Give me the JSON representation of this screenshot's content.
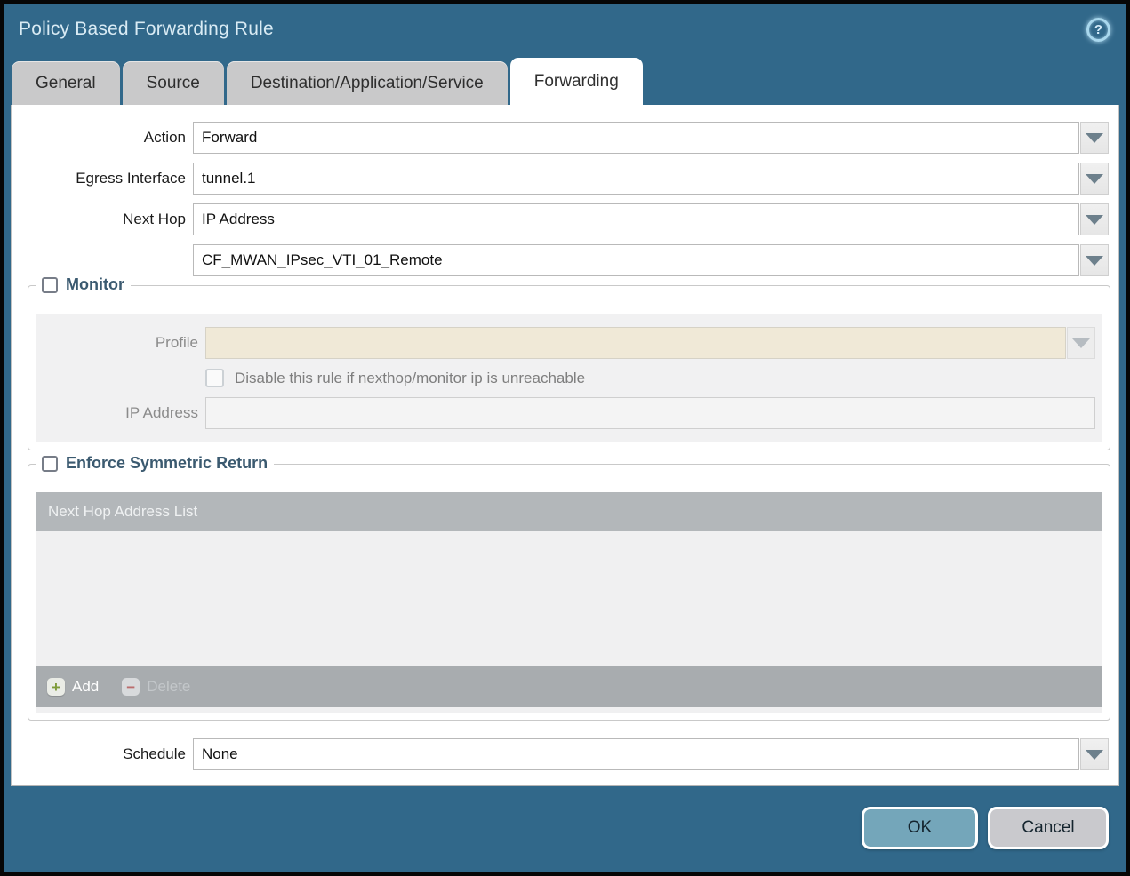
{
  "dialog": {
    "title": "Policy Based Forwarding Rule"
  },
  "icons": {
    "help": "?",
    "add": "+",
    "delete": "−",
    "dropdown": "triangle-down"
  },
  "tabs": [
    {
      "label": "General",
      "active": false
    },
    {
      "label": "Source",
      "active": false
    },
    {
      "label": "Destination/Application/Service",
      "active": false
    },
    {
      "label": "Forwarding",
      "active": true
    }
  ],
  "form": {
    "action": {
      "label": "Action",
      "value": "Forward"
    },
    "egress_interface": {
      "label": "Egress Interface",
      "value": "tunnel.1"
    },
    "next_hop": {
      "label": "Next Hop",
      "value": "IP Address"
    },
    "next_hop_address": {
      "value": "CF_MWAN_IPsec_VTI_01_Remote"
    },
    "monitor": {
      "legend": "Monitor",
      "checked": false,
      "profile": {
        "label": "Profile",
        "value": ""
      },
      "disable_rule": {
        "label": "Disable this rule if nexthop/monitor ip is unreachable",
        "checked": false
      },
      "ip_address": {
        "label": "IP Address",
        "value": ""
      }
    },
    "enforce_symmetric_return": {
      "legend": "Enforce Symmetric Return",
      "checked": false,
      "table_header": "Next Hop Address List",
      "rows": [],
      "add_label": "Add",
      "delete_label": "Delete"
    },
    "schedule": {
      "label": "Schedule",
      "value": "None"
    }
  },
  "footer": {
    "ok_label": "OK",
    "cancel_label": "Cancel"
  },
  "colors": {
    "chrome_teal": "#31688a",
    "active_tab": "#ffffff",
    "inactive_tab": "#c9c9ca",
    "disabled_beige": "#f0e9d7",
    "table_header_gray": "#b3b7ba",
    "table_footer_gray": "#a8acaf",
    "ok_button": "#74a6ba",
    "cancel_button": "#c9c9cd",
    "legend_text": "#3b5a70",
    "add_green": "#7e9b39",
    "delete_red": "#bb6d6d"
  }
}
